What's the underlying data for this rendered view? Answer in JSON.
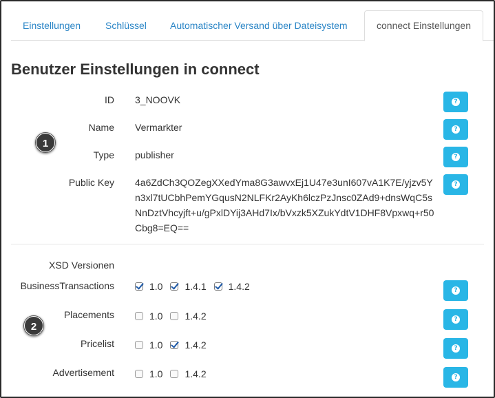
{
  "tabs": [
    {
      "label": "Einstellungen"
    },
    {
      "label": "Schlüssel"
    },
    {
      "label": "Automatischer Versand über Dateisystem"
    },
    {
      "label": "connect Einstellungen"
    }
  ],
  "page_title": "Benutzer Einstellungen in connect",
  "fields": {
    "id": {
      "label": "ID",
      "value": "3_NOOVK"
    },
    "name": {
      "label": "Name",
      "value": "Vermarkter"
    },
    "type": {
      "label": "Type",
      "value": "publisher"
    },
    "public_key": {
      "label": "Public Key",
      "value": "4a6ZdCh3QOZegXXedYma8G3awvxEj1U47e3unI607vA1K7E/yjzv5Yn3xl7tUCbhPemYGqusN2NLFKr2AyKh6lczPzJnsc0ZAd9+dnsWqC5sNnDztVhcyjft+u/gPxlDYij3AHd7Ix/bVxzk5XZukYdtV1DHF8Vpxwq+r50Cbg8=EQ=="
    }
  },
  "markers": [
    "1",
    "2"
  ],
  "xsd": {
    "heading": "XSD Versionen",
    "rows": [
      {
        "label": "BusinessTransactions",
        "options": [
          {
            "version": "1.0",
            "checked": true
          },
          {
            "version": "1.4.1",
            "checked": true
          },
          {
            "version": "1.4.2",
            "checked": true
          }
        ]
      },
      {
        "label": "Placements",
        "options": [
          {
            "version": "1.0",
            "checked": false
          },
          {
            "version": "1.4.2",
            "checked": false
          }
        ]
      },
      {
        "label": "Pricelist",
        "options": [
          {
            "version": "1.0",
            "checked": false
          },
          {
            "version": "1.4.2",
            "checked": true
          }
        ]
      },
      {
        "label": "Advertisement",
        "options": [
          {
            "version": "1.0",
            "checked": false
          },
          {
            "version": "1.4.2",
            "checked": false
          }
        ]
      }
    ]
  },
  "help_icon": "question-icon",
  "colors": {
    "accent": "#29b6e6",
    "link": "#2a85c6"
  }
}
